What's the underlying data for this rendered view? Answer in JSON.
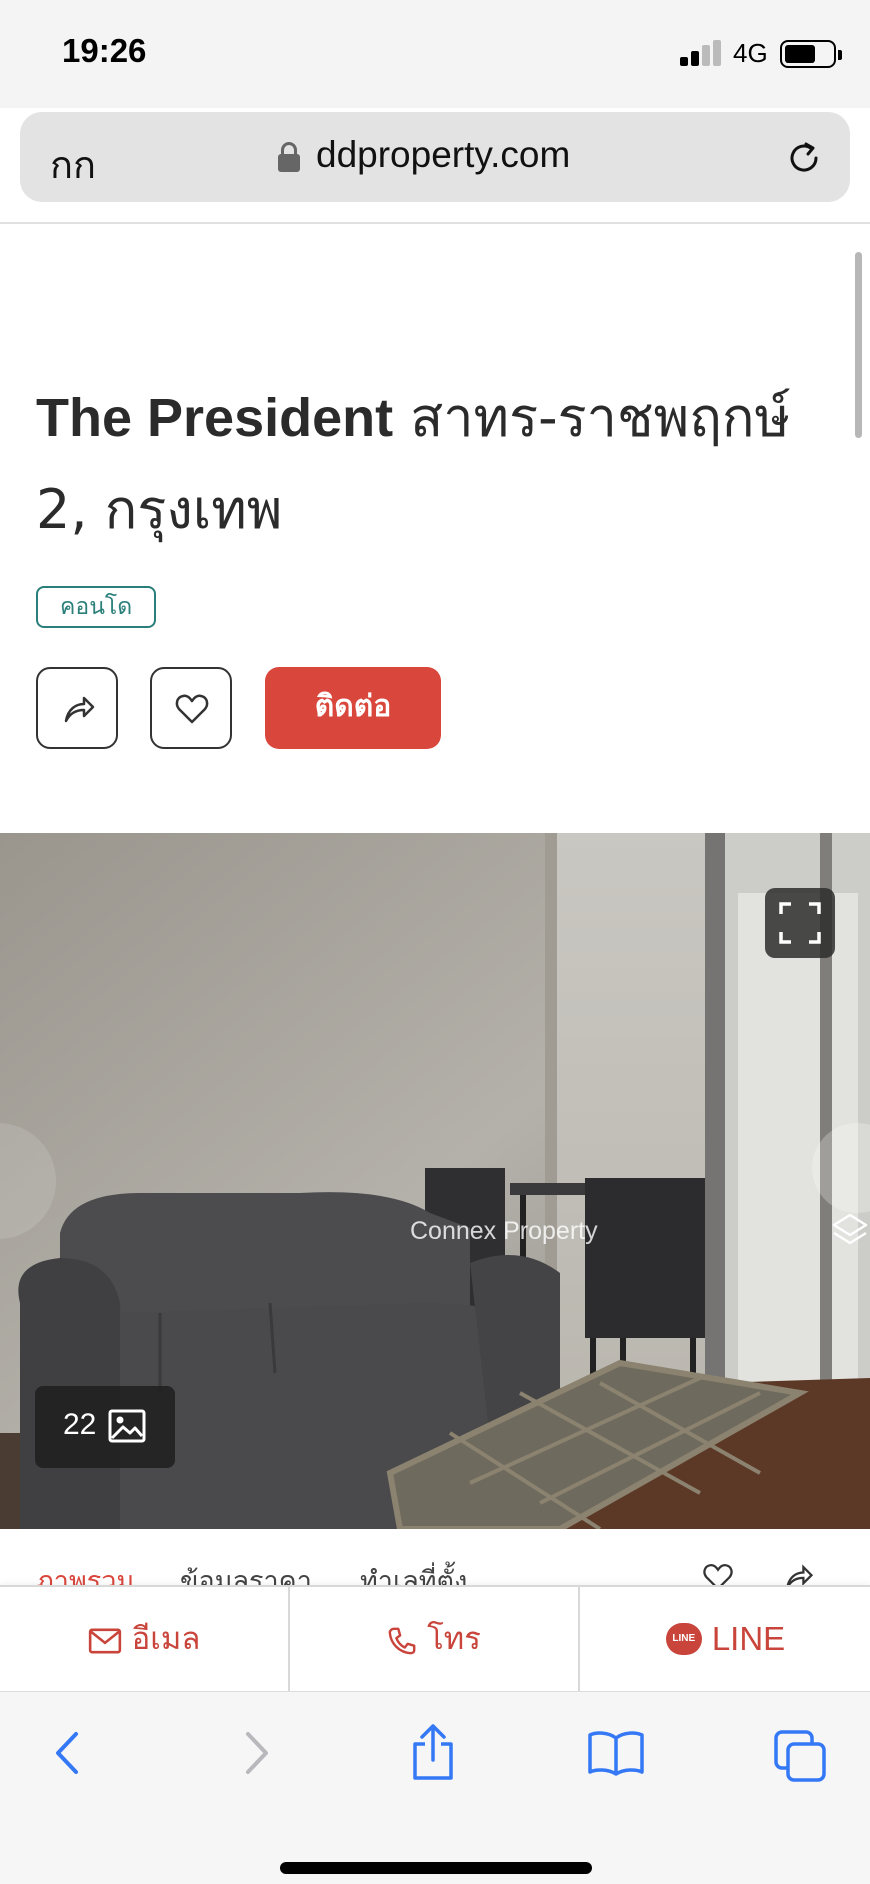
{
  "status_bar": {
    "time": "19:26",
    "network": "4G"
  },
  "browser": {
    "text_size_label": "กก",
    "url": "ddproperty.com"
  },
  "listing": {
    "title_en": "The President",
    "title_th": "สาทร-ราชพฤกษ์ 2, กรุงเทพ",
    "property_type": "คอนโด",
    "contact_label": "ติดต่อ"
  },
  "gallery": {
    "photo_count": "22",
    "watermark": "Connex Property"
  },
  "tabs": [
    "ภาพรวม",
    "ข้อมูลราคา",
    "ทำเลที่ตั้ง"
  ],
  "contact_bar": {
    "email_label": "อีเมล",
    "call_label": "โทร",
    "line_label": "LINE",
    "line_badge": "LINE"
  },
  "colors": {
    "accent": "#d9473c",
    "badge": "#2a7f7a",
    "ios_blue": "#3478f6"
  },
  "icons": [
    "lock-icon",
    "reload-icon",
    "share-icon",
    "heart-icon",
    "fullscreen-icon",
    "image-icon",
    "layers-icon",
    "mail-icon",
    "phone-icon",
    "back-icon",
    "forward-icon",
    "share-sheet-icon",
    "bookmarks-icon",
    "tabs-icon"
  ]
}
